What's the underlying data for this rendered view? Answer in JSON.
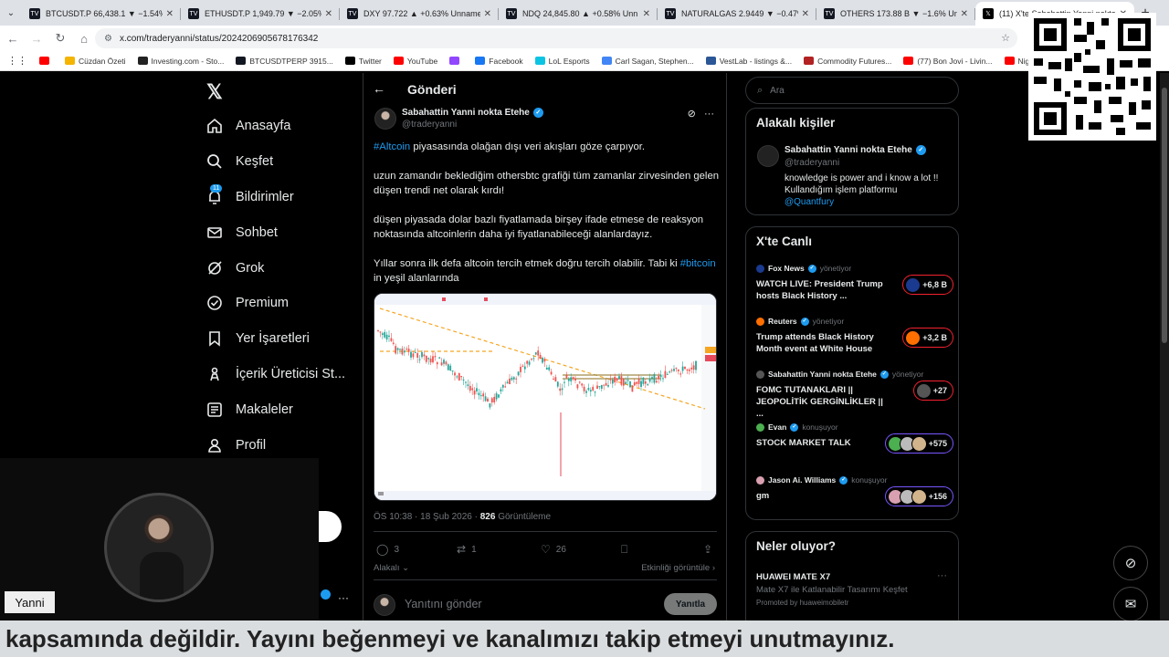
{
  "browser": {
    "tabs": [
      {
        "title": "BTCUSDT.P 66,438.1 ▼ −1.54%",
        "color": "#131722",
        "icon": "tv"
      },
      {
        "title": "ETHUSDT.P 1,949.79 ▼ −2.05%",
        "color": "#131722",
        "icon": "tv"
      },
      {
        "title": "DXY 97.722 ▲ +0.63% Unname",
        "color": "#131722",
        "icon": "tv"
      },
      {
        "title": "NDQ 24,845.80 ▲ +0.58% Unn",
        "color": "#131722",
        "icon": "tv"
      },
      {
        "title": "NATURALGAS 2.9449 ▼ −0.47%",
        "color": "#131722",
        "icon": "tv"
      },
      {
        "title": "OTHERS 173.88 B ▼ −1.6% Unn",
        "color": "#131722",
        "icon": "tv"
      },
      {
        "title": "(11) X'te Sabahattin Yanni nokta",
        "color": "#000000",
        "icon": "x",
        "active": true
      }
    ],
    "url": "x.com/traderyanni/status/2024206905678176342",
    "bookmarks": [
      {
        "label": "",
        "color": "#ff0000"
      },
      {
        "label": "Cüzdan Özeti",
        "color": "#f4b400"
      },
      {
        "label": "Investing.com - Sto...",
        "color": "#222222"
      },
      {
        "label": "BTCUSDTPERP 3915...",
        "color": "#131722"
      },
      {
        "label": "Twitter",
        "color": "#000000"
      },
      {
        "label": "YouTube",
        "color": "#ff0000"
      },
      {
        "label": "",
        "color": "#9146ff"
      },
      {
        "label": "Facebook",
        "color": "#1877f2"
      },
      {
        "label": "LoL Esports",
        "color": "#0bc4e3"
      },
      {
        "label": "Carl Sagan, Stephen...",
        "color": "#4285f4"
      },
      {
        "label": "VestLab - listings &...",
        "color": "#2b5797"
      },
      {
        "label": "Commodity Futures...",
        "color": "#b22222"
      },
      {
        "label": "(77) Bon Jovi - Livin...",
        "color": "#ff0000"
      },
      {
        "label": "Nightcall - YouTube",
        "color": "#ff0000"
      }
    ]
  },
  "nav": {
    "logo": "𝕏",
    "items": [
      {
        "label": "Anasayfa",
        "icon": "home-icon"
      },
      {
        "label": "Keşfet",
        "icon": "search-icon"
      },
      {
        "label": "Bildirimler",
        "icon": "bell-icon",
        "badge": "11"
      },
      {
        "label": "Sohbet",
        "icon": "mail-icon"
      },
      {
        "label": "Grok",
        "icon": "grok-icon"
      },
      {
        "label": "Premium",
        "icon": "premium-icon"
      },
      {
        "label": "Yer İşaretleri",
        "icon": "bookmark-icon"
      },
      {
        "label": "İçerik Üreticisi St...",
        "icon": "creator-icon"
      },
      {
        "label": "Makaleler",
        "icon": "articles-icon"
      },
      {
        "label": "Profil",
        "icon": "profile-icon"
      }
    ]
  },
  "post": {
    "header_title": "Gönderi",
    "author_name": "Sabahattin Yanni nokta Etehe",
    "author_handle": "@traderyanni",
    "p1_tag": "#Altcoin",
    "p1_rest": " piyasasında olağan dışı veri akışları göze çarpıyor.",
    "p2": "uzun zamandır beklediğim othersbtc grafiği tüm zamanlar zirvesinden gelen düşen trendi  net olarak kırdı!",
    "p3": "düşen piyasada dolar bazlı fiyatlamada birşey ifade etmese de reaksyon noktasında altcoinlerin daha iyi fiyatlanabileceği alanlardayız.",
    "p4_start": "Yıllar sonra ilk defa altcoin tercih etmek doğru tercih olabilir. Tabi ki ",
    "p4_tag": "#bitcoin",
    "p4_end": " in yeşil alanlarında",
    "time": "ÖS 10:38 · 18 Şub 2026 · ",
    "views_count": "826",
    "views_label": " Görüntüleme",
    "replies": "3",
    "reposts": "1",
    "likes": "26",
    "sort_label": "Alakalı",
    "activity_label": "Etkinliği görüntüle",
    "reply_placeholder": "Yanıtını gönder",
    "reply_button": "Yanıtla"
  },
  "right": {
    "search_placeholder": "Ara",
    "related_title": "Alakalı kişiler",
    "related_name": "Sabahattin Yanni nokta Etehe",
    "related_handle": "@traderyanni",
    "related_bio": "knowledge is power and i know a lot !! Kullandığım işlem platformu",
    "related_link": "@Quantfury",
    "live_title": "X'te Canlı",
    "live": [
      {
        "host": "Fox News",
        "role": "yönetiyor",
        "title": "WATCH LIVE: President Trump hosts Black History ...",
        "count": "+6,8 B",
        "color": "#1a3a8f",
        "ring": "red"
      },
      {
        "host": "Reuters",
        "role": "yönetiyor",
        "title": "Trump attends Black History Month event at White House",
        "count": "+3,2 B",
        "color": "#ff6f00",
        "ring": "red"
      },
      {
        "host": "Sabahattin Yanni nokta Etehe",
        "role": "yönetiyor",
        "title": "FOMC TUTANAKLARI  || JEOPOLİTİK GERGİNLİKLER  || ...",
        "count": "+27",
        "color": "#555555",
        "ring": "red"
      },
      {
        "host": "Evan",
        "role": "konuşuyor",
        "title": "STOCK MARKET TALK",
        "count": "+575",
        "color": "#4caf50",
        "ring": "purple"
      },
      {
        "host": "Jason Ai. Williams",
        "role": "konuşuyor",
        "title": "gm",
        "count": "+156",
        "color": "#d8a0b0",
        "ring": "purple"
      }
    ],
    "trend_title": "Neler oluyor?",
    "trend_name": "HUAWEI MATE X7",
    "trend_desc": "Mate X7 ile Katlanabilir Tasarımı Keşfet",
    "trend_promo": "Promoted by huaweimobiletr"
  },
  "overlay": {
    "cam_name": "Yanni",
    "subtitle": "kapsamında değildir. Yayını beğenmeyi ve kanalımızı takip etmeyi unutmayınız."
  }
}
